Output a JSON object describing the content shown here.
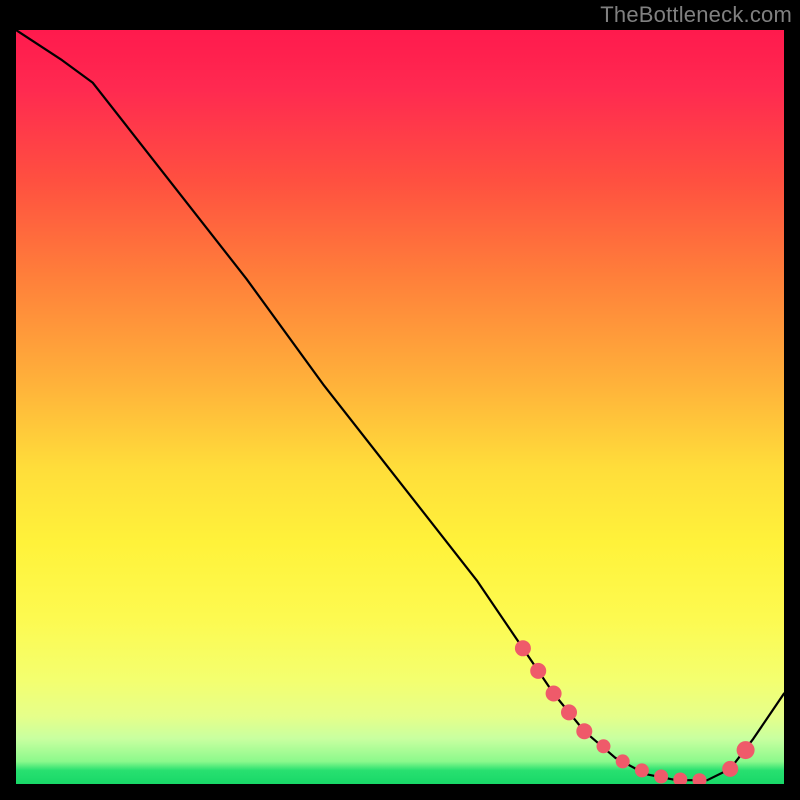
{
  "watermark": "TheBottleneck.com",
  "colors": {
    "background": "#000000",
    "curve": "#000000",
    "marker": "#ef5a6a",
    "gradient_top": "#ff1a4d",
    "gradient_bottom": "#18d868"
  },
  "chart_data": {
    "type": "line",
    "title": "",
    "xlabel": "",
    "ylabel": "",
    "xlim": [
      0,
      100
    ],
    "ylim": [
      0,
      100
    ],
    "series": [
      {
        "name": "bottleneck-curve",
        "x": [
          0,
          6,
          10,
          20,
          30,
          40,
          50,
          60,
          66,
          70,
          74,
          78,
          82,
          86,
          90,
          93,
          96,
          100
        ],
        "y": [
          100,
          96,
          93,
          80,
          67,
          53,
          40,
          27,
          18,
          12,
          7,
          3.5,
          1.3,
          0.5,
          0.5,
          2,
          6,
          12
        ]
      }
    ],
    "markers": {
      "name": "highlight-points",
      "x": [
        66,
        68,
        70,
        72,
        74,
        76.5,
        79,
        81.5,
        84,
        86.5,
        89,
        93,
        95
      ],
      "y": [
        18,
        15,
        12,
        9.5,
        7,
        5,
        3,
        1.8,
        1.0,
        0.6,
        0.5,
        2.0,
        4.5
      ],
      "size": [
        8,
        8,
        8,
        8,
        8,
        7,
        7,
        7,
        7,
        7,
        7,
        8,
        9
      ]
    },
    "notes": "Axes unlabeled in source image; x and y expressed as 0–100 percent of plot area. Curve descends near-linearly from top-left, bottoms out around x≈88, then rises toward the right edge."
  }
}
